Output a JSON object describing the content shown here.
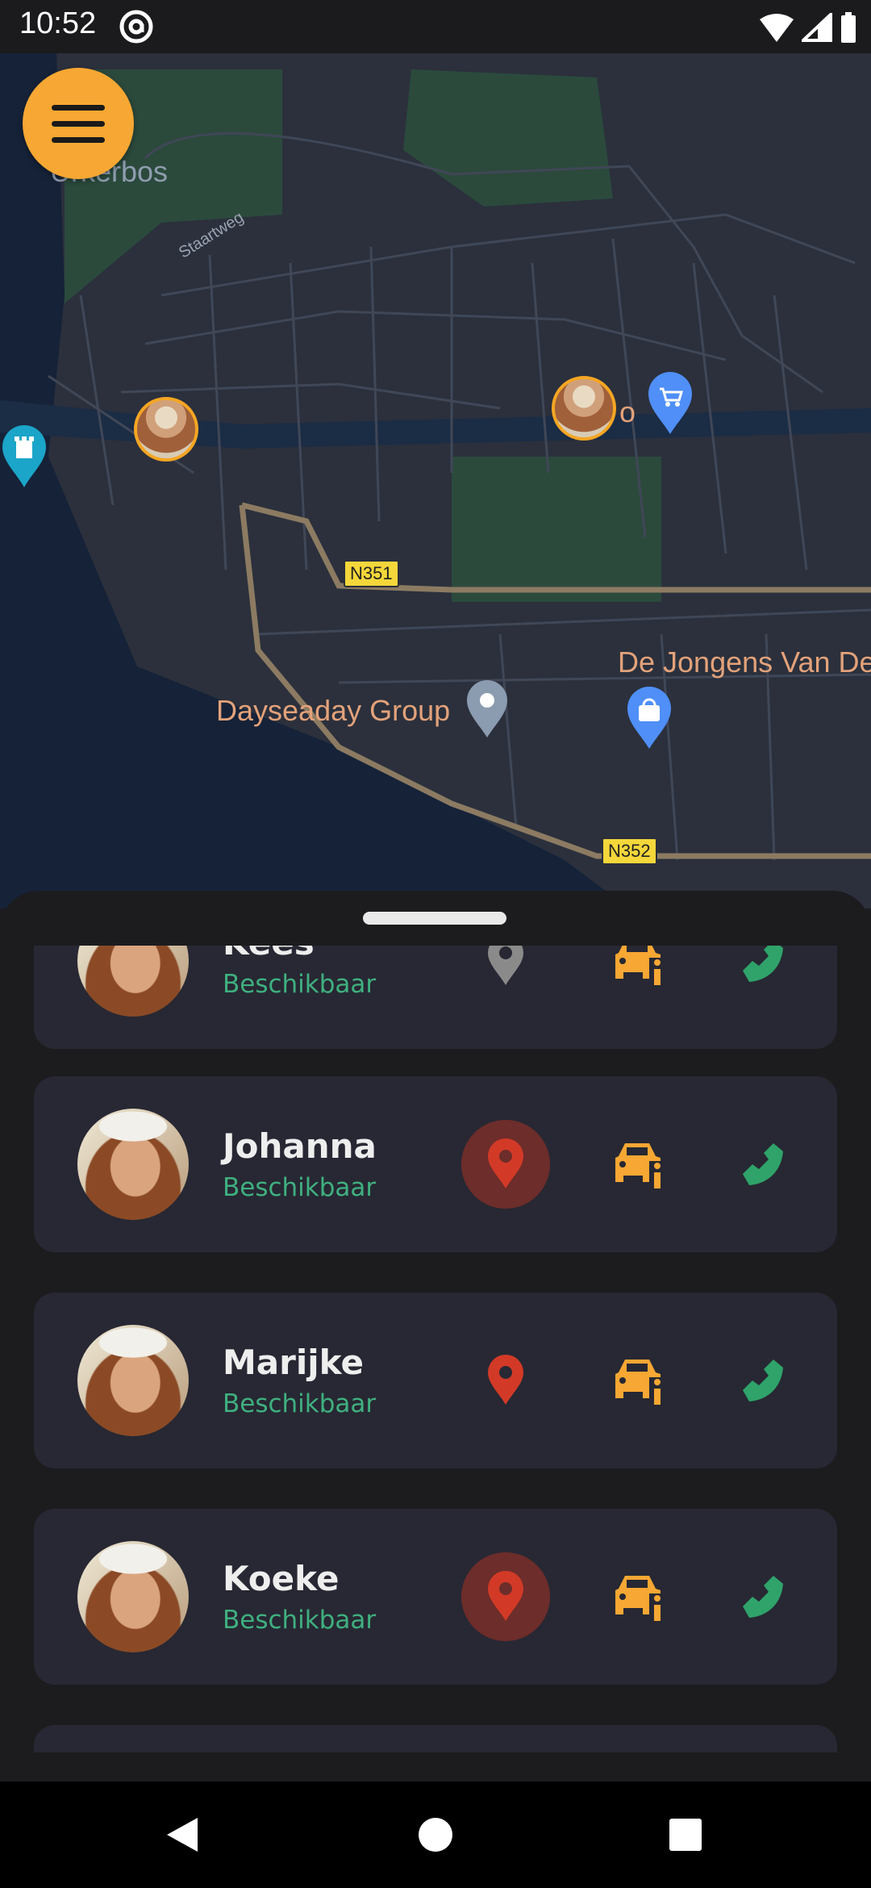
{
  "status_bar": {
    "time": "10:52"
  },
  "map": {
    "labels": {
      "urkerbos": "Urkerbos",
      "staartweg": "Staartweg",
      "dayseaday": "Dayseaday Group",
      "jongens": "De Jongens Van De",
      "o_fragment": "o"
    },
    "roads": {
      "n351": "N351",
      "n352": "N352"
    }
  },
  "contacts": [
    {
      "name": "Kees",
      "status": "Beschikbaar",
      "pin_state": "inactive"
    },
    {
      "name": "Johanna",
      "status": "Beschikbaar",
      "pin_state": "active"
    },
    {
      "name": "Marijke",
      "status": "Beschikbaar",
      "pin_state": "red"
    },
    {
      "name": "Koeke",
      "status": "Beschikbaar",
      "pin_state": "active"
    }
  ],
  "colors": {
    "accent": "#f7a733",
    "available": "#3fb07f",
    "pin_red": "#d23a27",
    "pin_gray": "#8a8a8a",
    "phone_green": "#2fa36a"
  },
  "icons": {
    "menu": "hamburger-icon",
    "pin": "location-pin-icon",
    "car": "car-info-icon",
    "phone": "phone-icon"
  }
}
